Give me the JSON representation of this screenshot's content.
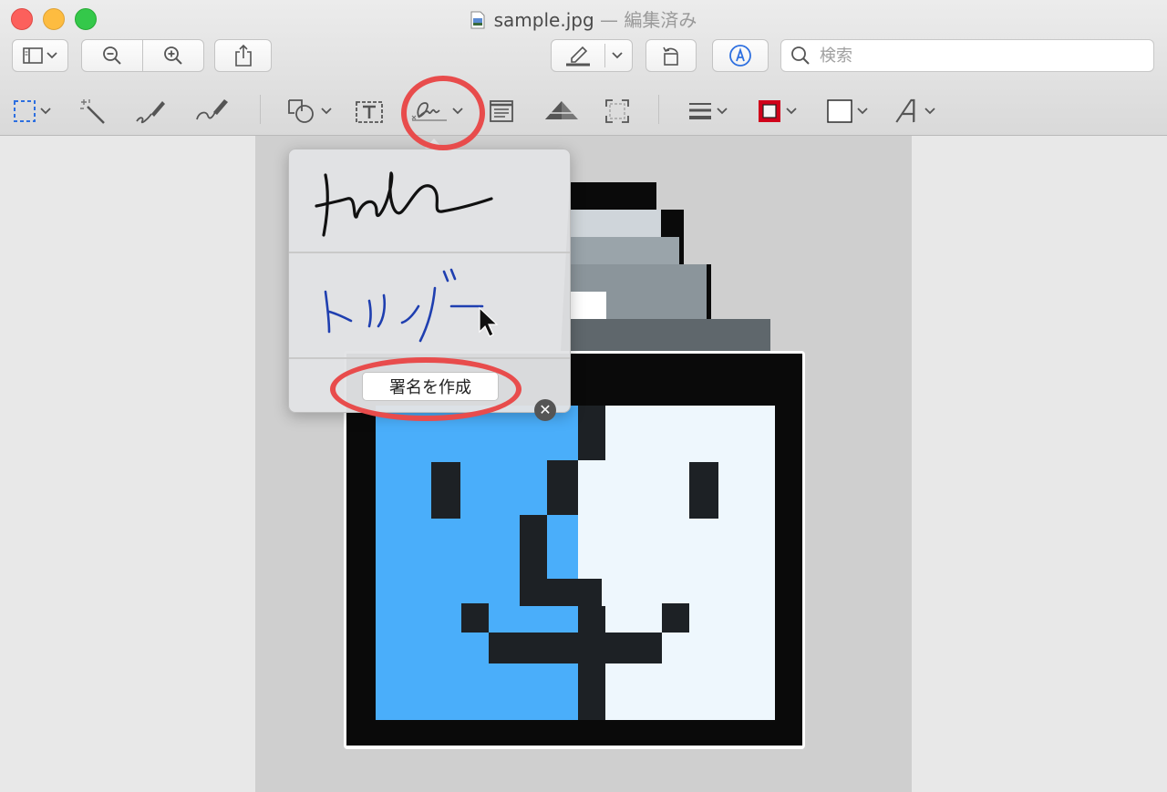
{
  "window": {
    "filename": "sample.jpg",
    "edited_label": "— 編集済み"
  },
  "toolbar": {
    "search_placeholder": "検索",
    "buttons": [
      "sidebar-toggle",
      "zoom-out",
      "zoom-in",
      "share",
      "markup-pen",
      "rotate",
      "annotate"
    ]
  },
  "markup_toolbar": {
    "tools": [
      "rectangular-selection",
      "instant-alpha",
      "sketch",
      "draw",
      "shapes",
      "text",
      "sign",
      "note",
      "adjust-color",
      "adjust-size",
      "line-style",
      "border-color",
      "fill-color",
      "text-style"
    ],
    "border_color": "#d0021b",
    "fill_color": "#ffffff"
  },
  "signature_popover": {
    "signatures": [
      "signature-1",
      "signature-2"
    ],
    "create_button_label": "署名を作成"
  },
  "colors": {
    "callout": "#e84c4c",
    "finder_blue": "#4aaefa",
    "finder_light": "#eef7fd",
    "selection_blue": "#2d6fe0"
  }
}
